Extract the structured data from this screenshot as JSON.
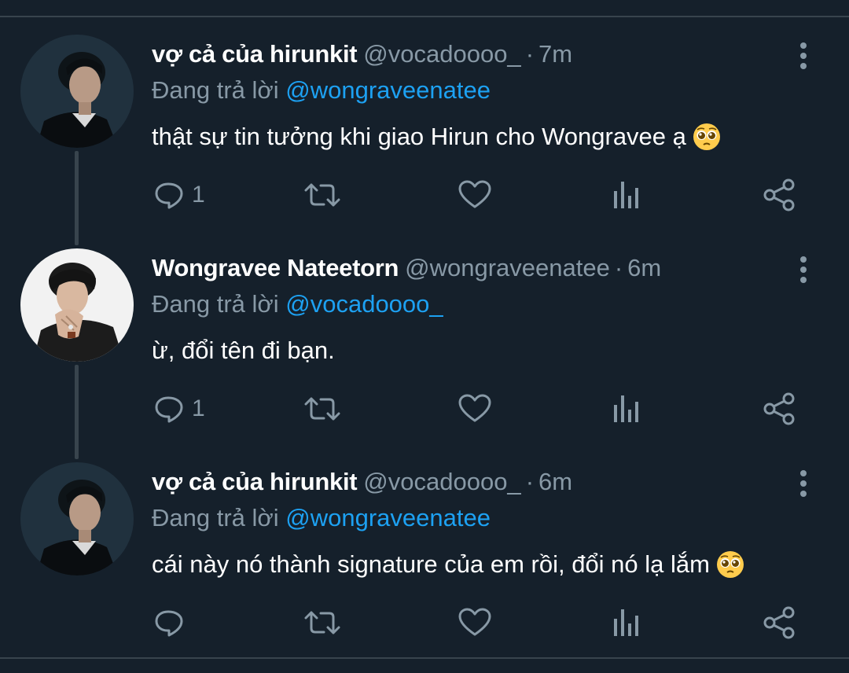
{
  "colors": {
    "background": "#15202b",
    "divider": "#38444d",
    "secondary_text": "#8899a6",
    "link": "#1da1f2"
  },
  "tweets": [
    {
      "display_name": "vợ cả của hirunkit",
      "handle": "@vocadoooo_",
      "separator": "·",
      "time": "7m",
      "reply_prefix": "Đang trả lời",
      "reply_to": "@wongraveenatee",
      "text": "thật sự tin tưởng khi giao Hirun cho Wongravee ạ",
      "emoji": "pleading-face-emoji",
      "reply_count": "1",
      "avatar": "user-avatar-vocadoooo"
    },
    {
      "display_name": "Wongravee Nateetorn",
      "handle": "@wongraveenatee",
      "separator": "·",
      "time": "6m",
      "reply_prefix": "Đang trả lời",
      "reply_to": "@vocadoooo_",
      "text": "ừ, đổi tên đi bạn.",
      "reply_count": "1",
      "avatar": "user-avatar-wongraveenatee"
    },
    {
      "display_name": "vợ cả của hirunkit",
      "handle": "@vocadoooo_",
      "separator": "·",
      "time": "6m",
      "reply_prefix": "Đang trả lời",
      "reply_to": "@wongraveenatee",
      "text": "cái này nó thành signature của em rồi, đổi nó lạ lắm",
      "emoji": "pleading-face-emoji",
      "reply_count": "",
      "avatar": "user-avatar-vocadoooo"
    }
  ],
  "action_icons": [
    "reply-icon",
    "retweet-icon",
    "like-icon",
    "analytics-icon",
    "share-icon"
  ]
}
